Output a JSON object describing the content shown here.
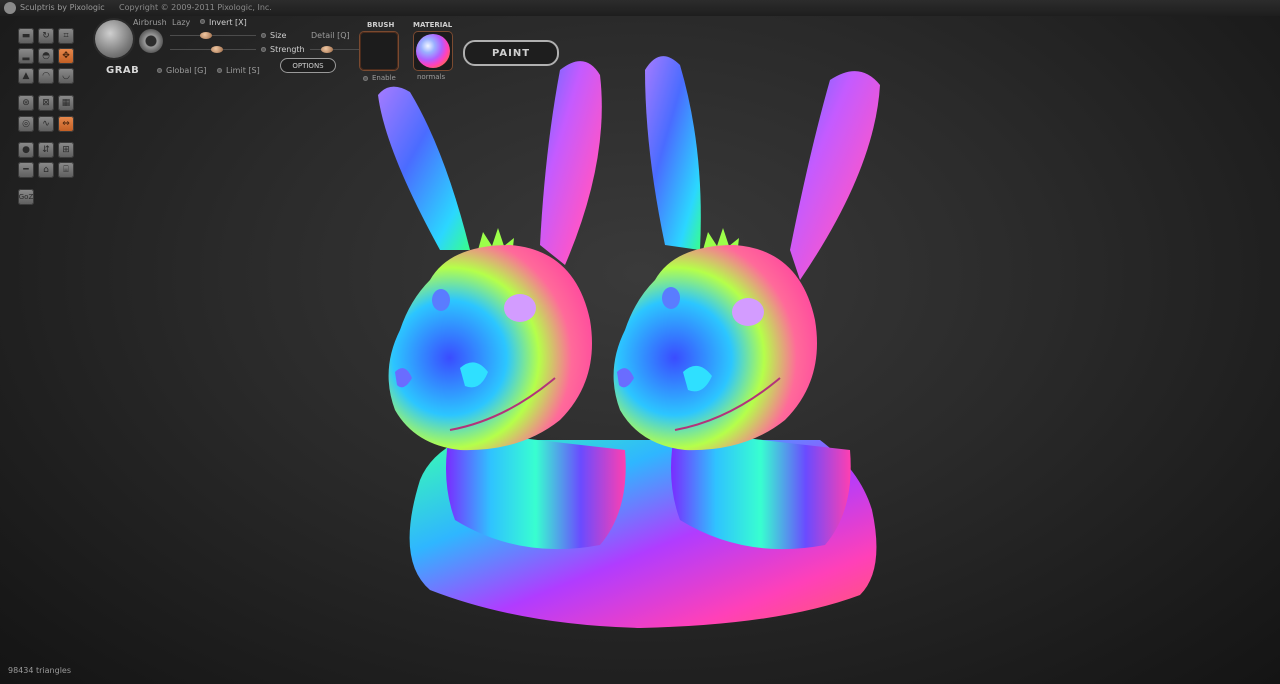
{
  "titlebar": {
    "app_title": "Sculptris by Pixologic",
    "copyright": "Copyright © 2009-2011 Pixologic, Inc."
  },
  "tools": {
    "left_panel": [
      {
        "name": "draw",
        "icon": "draw-icon",
        "active": false
      },
      {
        "name": "rotate",
        "icon": "rotate-icon",
        "active": false
      },
      {
        "name": "crop",
        "icon": "crop-icon",
        "active": false
      },
      {
        "name": "flatten",
        "icon": "flatten-icon",
        "active": false
      },
      {
        "name": "inflate",
        "icon": "inflate-icon",
        "active": false
      },
      {
        "name": "grab",
        "icon": "grab-icon",
        "active": true
      },
      {
        "name": "pinch",
        "icon": "pinch-icon",
        "active": false
      },
      {
        "name": "smooth",
        "icon": "smooth-icon",
        "active": false
      },
      {
        "name": "crease",
        "icon": "crease-icon",
        "active": false
      },
      {
        "name": "twist",
        "icon": "twist-icon",
        "active": false
      },
      {
        "name": "subdivide",
        "icon": "subdivide-icon",
        "active": false
      },
      {
        "name": "grid",
        "icon": "grid-icon",
        "active": false
      },
      {
        "name": "symmetry",
        "icon": "symmetry-icon",
        "active": false
      },
      {
        "name": "wire",
        "icon": "wire-icon",
        "active": false
      },
      {
        "name": "mirror",
        "icon": "mirror-icon",
        "active": true
      },
      {
        "name": "sphere",
        "icon": "sphere-icon",
        "active": false
      },
      {
        "name": "scale",
        "icon": "scale-icon",
        "active": false
      },
      {
        "name": "tile",
        "icon": "tile-icon",
        "active": false
      },
      {
        "name": "plane",
        "icon": "plane-icon",
        "active": false
      },
      {
        "name": "house",
        "icon": "house-icon",
        "active": false
      },
      {
        "name": "reduce",
        "icon": "reduce-icon",
        "active": false
      },
      {
        "name": "goz",
        "icon": "goz-icon",
        "active": false
      }
    ],
    "goz_label": "GoZ"
  },
  "brush": {
    "mode": "GRAB",
    "airbrush": "Airbrush",
    "lazy": "Lazy",
    "invert": "Invert [X]",
    "size": "Size",
    "detail": "Detail [Q]",
    "strength": "Strength",
    "options": "OPTIONS",
    "global": "Global [G]",
    "limit": "Limit [S]",
    "size_level": 0.4,
    "strength_level": 0.55
  },
  "brush_panel": {
    "heading": "BRUSH",
    "enable": "Enable"
  },
  "material_panel": {
    "heading": "MATERIAL",
    "name": "normals"
  },
  "paint_button": "PAINT",
  "status": {
    "triangles": "98434 triangles"
  }
}
